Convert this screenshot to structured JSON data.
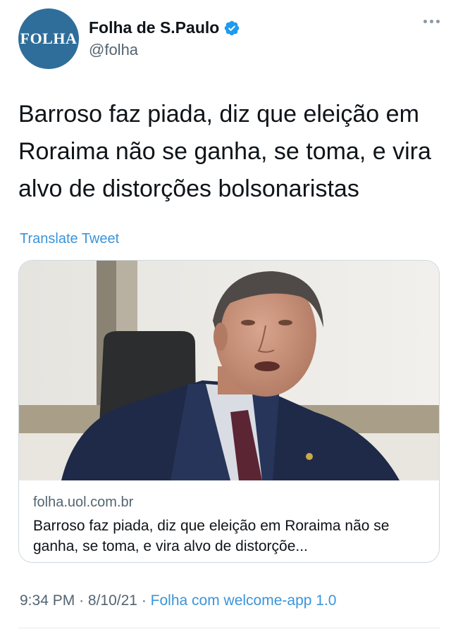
{
  "account": {
    "avatar_text": "FOLHA",
    "display_name": "Folha de S.Paulo",
    "handle": "@folha",
    "verified": true,
    "verified_icon": "verified-badge-icon",
    "more_icon": "more-options-icon"
  },
  "tweet": {
    "text": "Barroso faz piada, diz que eleição em Roraima não se ganha, se toma, e vira alvo de distorções bolsonaristas",
    "translate_label": "Translate Tweet"
  },
  "card": {
    "domain": "folha.uol.com.br",
    "title": "Barroso faz piada, diz que eleição em Roraima não se ganha, se toma, e vira alvo de distorçõe..."
  },
  "meta": {
    "time": "9:34 PM",
    "separator": "·",
    "date": "8/10/21",
    "app": "Folha com welcome-app 1.0"
  },
  "colors": {
    "avatar_bg": "#2f6e9a",
    "link": "#3b94d9",
    "secondary_text": "#536471",
    "verified": "#1d9bf0"
  }
}
